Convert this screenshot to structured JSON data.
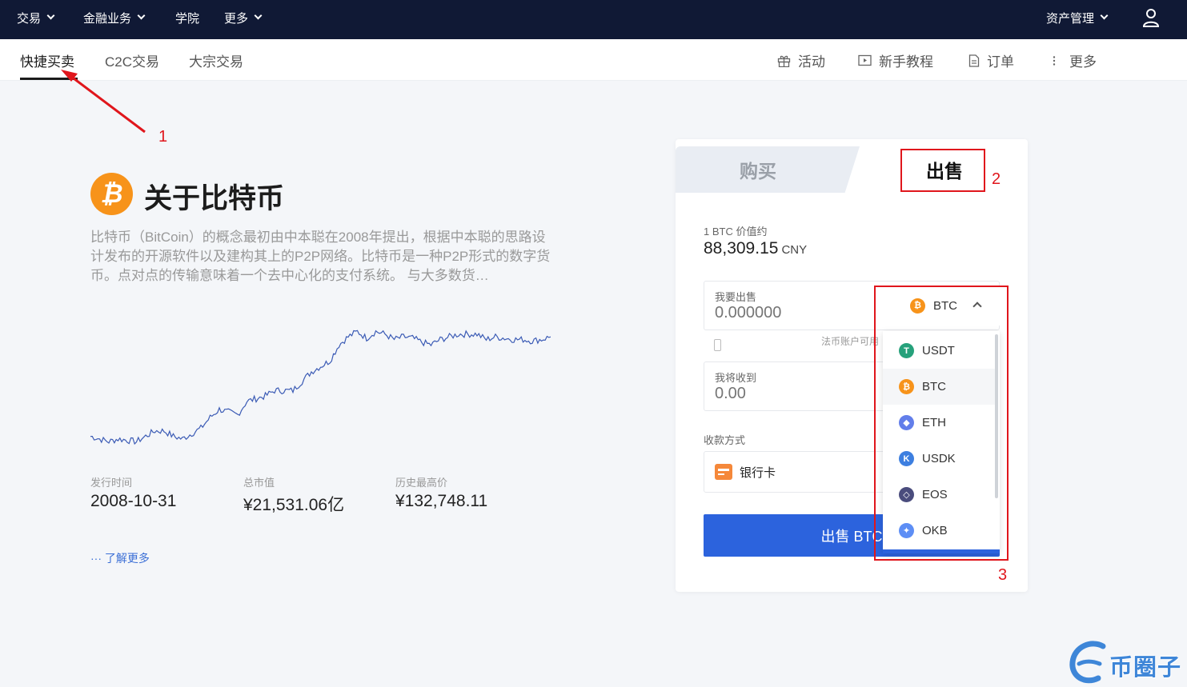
{
  "topnav": {
    "items": [
      {
        "label": "交易",
        "has_dropdown": true
      },
      {
        "label": "金融业务",
        "has_dropdown": true
      },
      {
        "label": "学院",
        "has_dropdown": false
      },
      {
        "label": "更多",
        "has_dropdown": true
      }
    ],
    "asset_management": "资产管理",
    "user_icon": "user-icon"
  },
  "subnav": {
    "tabs": [
      {
        "label": "快捷买卖",
        "active": true
      },
      {
        "label": "C2C交易",
        "active": false
      },
      {
        "label": "大宗交易",
        "active": false
      }
    ],
    "links": [
      {
        "label": "活动",
        "icon": "gift-icon"
      },
      {
        "label": "新手教程",
        "icon": "play-icon"
      },
      {
        "label": "订单",
        "icon": "document-icon"
      },
      {
        "label": "更多",
        "icon": "dots-vertical-icon"
      }
    ]
  },
  "about": {
    "title": "关于比特币",
    "coin_symbol": "₿",
    "description": "比特币（BitCoin）的概念最初由中本聪在2008年提出，根据中本聪的思路设计发布的开源软件以及建构其上的P2P网络。比特币是一种P2P形式的数字货币。点对点的传输意味着一个去中心化的支付系统。 与大多数货…",
    "stats": [
      {
        "label": "发行时间",
        "value": "2008-10-31"
      },
      {
        "label": "总市值",
        "value": "¥21,531.06亿"
      },
      {
        "label": "历史最高价",
        "value": "¥132,748.11"
      }
    ],
    "learn_more": "··· 了解更多"
  },
  "trade_card": {
    "buy_tab": "购买",
    "sell_tab": "出售",
    "active_tab": "sell",
    "price_label": "1 BTC 价值约",
    "price_value": "88,309.15",
    "price_currency": "CNY",
    "sell_field": {
      "label": "我要出售",
      "placeholder": "0.000000"
    },
    "hint": "法币账户可用",
    "receive_field": {
      "label": "我将收到",
      "placeholder": "0.00"
    },
    "payment_label": "收款方式",
    "payment_method": "银行卡",
    "submit_label": "出售 BTC",
    "selected_coin": "BTC",
    "coin_options": [
      {
        "symbol": "USDT",
        "color": "#26a17b",
        "glyph": "T",
        "selected": false
      },
      {
        "symbol": "BTC",
        "color": "#f7931a",
        "glyph": "₿",
        "selected": true
      },
      {
        "symbol": "ETH",
        "color": "#627eea",
        "glyph": "◆",
        "selected": false
      },
      {
        "symbol": "USDK",
        "color": "#3d7fe0",
        "glyph": "K",
        "selected": false
      },
      {
        "symbol": "EOS",
        "color": "#4a4c7d",
        "glyph": "◇",
        "selected": false
      },
      {
        "symbol": "OKB",
        "color": "#5d8ef5",
        "glyph": "✦",
        "selected": false
      }
    ]
  },
  "annotations": {
    "labels": [
      "1",
      "2",
      "3"
    ],
    "color": "#e0161c"
  },
  "watermark": {
    "text": "币圈子"
  },
  "chart_data": {
    "type": "line",
    "title": "",
    "xlabel": "",
    "ylabel": "",
    "grid": false,
    "x": [
      0,
      2,
      4,
      6,
      8,
      10,
      12,
      14,
      16,
      18,
      20,
      22,
      24,
      26,
      28,
      30,
      32,
      34,
      36,
      38,
      40,
      42,
      44,
      46,
      48,
      50,
      52,
      54,
      56,
      58,
      60,
      62,
      64,
      66,
      68,
      70,
      72,
      74,
      76,
      78,
      80,
      82,
      84,
      86,
      88,
      90,
      92,
      94,
      96,
      98,
      100
    ],
    "values": [
      14,
      12,
      10,
      12,
      11,
      10,
      14,
      18,
      18,
      14,
      12,
      16,
      20,
      28,
      34,
      32,
      30,
      40,
      42,
      44,
      48,
      48,
      48,
      55,
      62,
      66,
      70,
      82,
      88,
      92,
      87,
      92,
      90,
      86,
      88,
      87,
      84,
      82,
      86,
      88,
      90,
      90,
      90,
      86,
      88,
      87,
      86,
      86,
      85,
      86,
      88
    ],
    "ylim": [
      0,
      100
    ],
    "series_color": "#3b5bb5"
  }
}
